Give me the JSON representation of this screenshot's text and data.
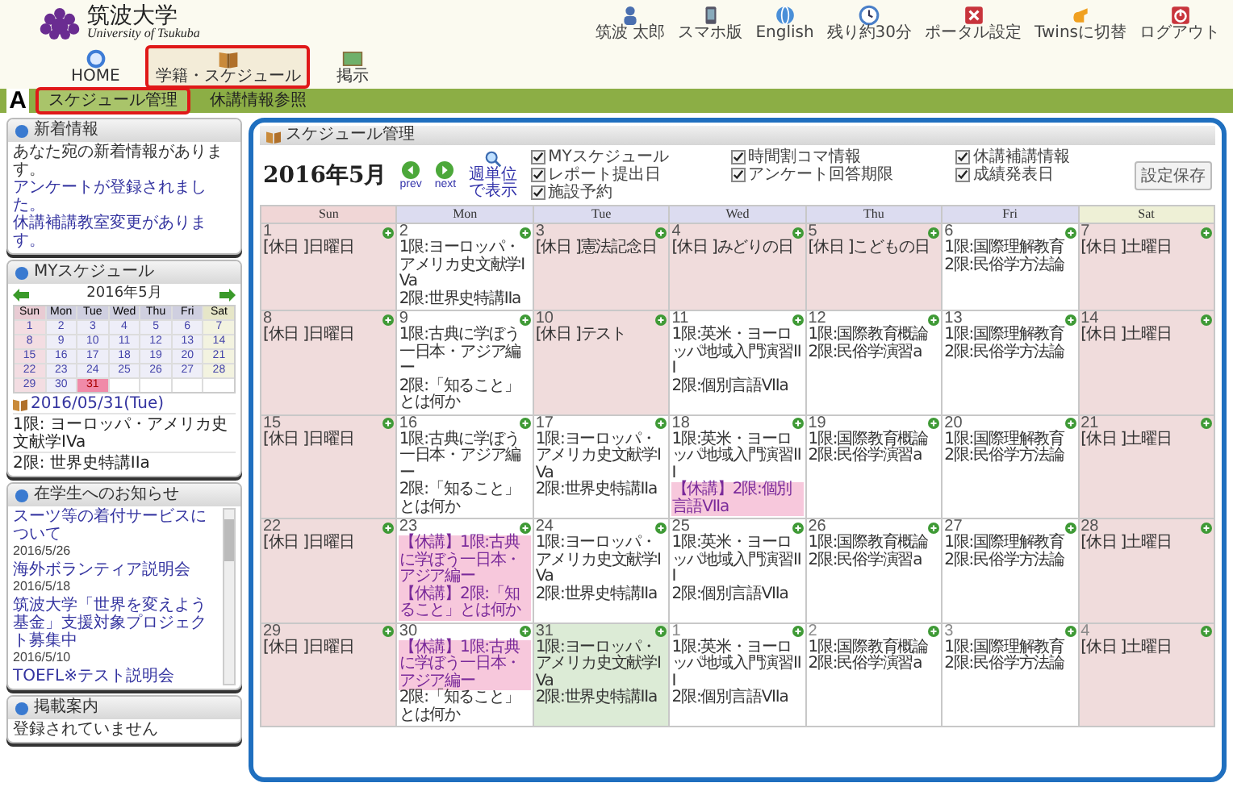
{
  "logo": {
    "name": "筑波大学",
    "subtitle": "University of Tsukuba"
  },
  "top_links": [
    {
      "label": "筑波 太郎"
    },
    {
      "label": "スマホ版"
    },
    {
      "label": "English"
    },
    {
      "label": "残り約30分"
    },
    {
      "label": "ポータル設定"
    },
    {
      "label": "Twinsに切替"
    },
    {
      "label": "ログアウト"
    }
  ],
  "nav": [
    {
      "label": "HOME",
      "selected": false
    },
    {
      "label": "学籍・スケジュール",
      "selected": true
    },
    {
      "label": "掲示",
      "selected": false
    }
  ],
  "annotation_label": "A",
  "subnav": [
    {
      "label": "スケジュール管理",
      "selected": true
    },
    {
      "label": "休講情報参照",
      "selected": false
    }
  ],
  "sidebar": {
    "news": {
      "title": "新着情報",
      "message": "あなた宛の新着情報があります。",
      "links": [
        "アンケートが登録されました。",
        "休講補講教室変更があります。"
      ]
    },
    "my_schedule": {
      "title": "MYスケジュール",
      "month": "2016年5月",
      "weekdays": [
        "Sun",
        "Mon",
        "Tue",
        "Wed",
        "Thu",
        "Fri",
        "Sat"
      ],
      "weeks": [
        [
          {
            "day": "1",
            "selected": false
          },
          {
            "day": "2",
            "selected": false
          },
          {
            "day": "3",
            "selected": false
          },
          {
            "day": "4",
            "selected": false
          },
          {
            "day": "5",
            "selected": false
          },
          {
            "day": "6",
            "selected": false
          },
          {
            "day": "7",
            "selected": false
          }
        ],
        [
          {
            "day": "8",
            "selected": false
          },
          {
            "day": "9",
            "selected": false
          },
          {
            "day": "10",
            "selected": false
          },
          {
            "day": "11",
            "selected": false
          },
          {
            "day": "12",
            "selected": false
          },
          {
            "day": "13",
            "selected": false
          },
          {
            "day": "14",
            "selected": false
          }
        ],
        [
          {
            "day": "15",
            "selected": false
          },
          {
            "day": "16",
            "selected": false
          },
          {
            "day": "17",
            "selected": false
          },
          {
            "day": "18",
            "selected": false
          },
          {
            "day": "19",
            "selected": false
          },
          {
            "day": "20",
            "selected": false
          },
          {
            "day": "21",
            "selected": false
          }
        ],
        [
          {
            "day": "22",
            "selected": false
          },
          {
            "day": "23",
            "selected": false
          },
          {
            "day": "24",
            "selected": false
          },
          {
            "day": "25",
            "selected": false
          },
          {
            "day": "26",
            "selected": false
          },
          {
            "day": "27",
            "selected": false
          },
          {
            "day": "28",
            "selected": false
          }
        ],
        [
          {
            "day": "29",
            "selected": false
          },
          {
            "day": "30",
            "selected": false
          },
          {
            "day": "31",
            "selected": true
          }
        ]
      ],
      "date": "2016/05/31(Tue)",
      "items": [
        "1限: ヨーロッパ・アメリカ史文献学IVa",
        "2限: 世界史特講IIa"
      ]
    },
    "notices": {
      "title": "在学生へのお知らせ",
      "items": [
        {
          "title": "スーツ等の着付サービスについて",
          "date": "2016/5/26"
        },
        {
          "title": "海外ボランティア説明会",
          "date": "2016/5/18"
        },
        {
          "title": "筑波大学「世界を変えよう基金」支援対象プロジェクト募集中",
          "date": "2016/5/10"
        },
        {
          "title": "TOEFL※テスト説明会"
        }
      ]
    },
    "bulletin": {
      "title": "掲載案内",
      "message": "登録されていません"
    }
  },
  "schedule": {
    "title": "スケジュール管理",
    "month": "2016年5月",
    "prev": "prev",
    "next": "next",
    "week_view": "週単位で表示",
    "filters": [
      {
        "label": "MYスケジュール",
        "checked": true
      },
      {
        "label": "時間割コマ情報",
        "checked": true
      },
      {
        "label": "休講補講情報",
        "checked": true
      },
      {
        "label": "レポート提出日",
        "checked": true
      },
      {
        "label": "アンケート回答期限",
        "checked": true
      },
      {
        "label": "成績発表日",
        "checked": true
      },
      {
        "label": "施設予約",
        "checked": true
      }
    ],
    "save_button": "設定保存",
    "weekdays": [
      "Sun",
      "Mon",
      "Tue",
      "Wed",
      "Thu",
      "Fri",
      "Sat"
    ],
    "weeks": [
      [
        {
          "day": "1",
          "holiday": true,
          "selected": false,
          "other_month": false,
          "entries": [
            {
              "text": "[休日 ]日曜日",
              "cancelled": false
            }
          ]
        },
        {
          "day": "2",
          "holiday": false,
          "selected": false,
          "other_month": false,
          "entries": [
            {
              "text": "1限:ヨーロッパ・アメリカ史文献学IVa",
              "cancelled": false
            },
            {
              "text": "2限:世界史特講IIa",
              "cancelled": false
            }
          ]
        },
        {
          "day": "3",
          "holiday": true,
          "selected": false,
          "other_month": false,
          "entries": [
            {
              "text": "[休日 ]憲法記念日",
              "cancelled": false
            }
          ]
        },
        {
          "day": "4",
          "holiday": true,
          "selected": false,
          "other_month": false,
          "entries": [
            {
              "text": "[休日 ]みどりの日",
              "cancelled": false
            }
          ]
        },
        {
          "day": "5",
          "holiday": true,
          "selected": false,
          "other_month": false,
          "entries": [
            {
              "text": "[休日 ]こどもの日",
              "cancelled": false
            }
          ]
        },
        {
          "day": "6",
          "holiday": false,
          "selected": false,
          "other_month": false,
          "entries": [
            {
              "text": "1限:国際理解教育",
              "cancelled": false
            },
            {
              "text": "2限:民俗学方法論",
              "cancelled": false
            }
          ]
        },
        {
          "day": "7",
          "holiday": true,
          "selected": false,
          "other_month": false,
          "entries": [
            {
              "text": "[休日 ]土曜日",
              "cancelled": false
            }
          ]
        }
      ],
      [
        {
          "day": "8",
          "holiday": true,
          "selected": false,
          "other_month": false,
          "entries": [
            {
              "text": "[休日 ]日曜日",
              "cancelled": false
            }
          ]
        },
        {
          "day": "9",
          "holiday": false,
          "selected": false,
          "other_month": false,
          "entries": [
            {
              "text": "1限:古典に学ぼう一日本・アジア編ー",
              "cancelled": false
            },
            {
              "text": "2限:「知ること」とは何か",
              "cancelled": false
            }
          ]
        },
        {
          "day": "10",
          "holiday": true,
          "selected": false,
          "other_month": false,
          "entries": [
            {
              "text": "[休日 ]テスト",
              "cancelled": false
            }
          ]
        },
        {
          "day": "11",
          "holiday": false,
          "selected": false,
          "other_month": false,
          "entries": [
            {
              "text": "1限:英米・ヨーロッパ地域入門演習III",
              "cancelled": false
            },
            {
              "text": "2限:個別言語VIIa",
              "cancelled": false
            }
          ]
        },
        {
          "day": "12",
          "holiday": false,
          "selected": false,
          "other_month": false,
          "entries": [
            {
              "text": "1限:国際教育概論",
              "cancelled": false
            },
            {
              "text": "2限:民俗学演習a",
              "cancelled": false
            }
          ]
        },
        {
          "day": "13",
          "holiday": false,
          "selected": false,
          "other_month": false,
          "entries": [
            {
              "text": "1限:国際理解教育",
              "cancelled": false
            },
            {
              "text": "2限:民俗学方法論",
              "cancelled": false
            }
          ]
        },
        {
          "day": "14",
          "holiday": true,
          "selected": false,
          "other_month": false,
          "entries": [
            {
              "text": "[休日 ]土曜日",
              "cancelled": false
            }
          ]
        }
      ],
      [
        {
          "day": "15",
          "holiday": true,
          "selected": false,
          "other_month": false,
          "entries": [
            {
              "text": "[休日 ]日曜日",
              "cancelled": false
            }
          ]
        },
        {
          "day": "16",
          "holiday": false,
          "selected": false,
          "other_month": false,
          "entries": [
            {
              "text": "1限:古典に学ぼう一日本・アジア編ー",
              "cancelled": false
            },
            {
              "text": "2限:「知ること」とは何か",
              "cancelled": false
            }
          ]
        },
        {
          "day": "17",
          "holiday": false,
          "selected": false,
          "other_month": false,
          "entries": [
            {
              "text": "1限:ヨーロッパ・アメリカ史文献学IVa",
              "cancelled": false
            },
            {
              "text": "2限:世界史特講IIa",
              "cancelled": false
            }
          ]
        },
        {
          "day": "18",
          "holiday": false,
          "selected": false,
          "other_month": false,
          "entries": [
            {
              "text": "1限:英米・ヨーロッパ地域入門演習III",
              "cancelled": false
            },
            {
              "text": "【休講】2限:個別言語VIIa",
              "cancelled": true
            }
          ]
        },
        {
          "day": "19",
          "holiday": false,
          "selected": false,
          "other_month": false,
          "entries": [
            {
              "text": "1限:国際教育概論",
              "cancelled": false
            },
            {
              "text": "2限:民俗学演習a",
              "cancelled": false
            }
          ]
        },
        {
          "day": "20",
          "holiday": false,
          "selected": false,
          "other_month": false,
          "entries": [
            {
              "text": "1限:国際理解教育",
              "cancelled": false
            },
            {
              "text": "2限:民俗学方法論",
              "cancelled": false
            }
          ]
        },
        {
          "day": "21",
          "holiday": true,
          "selected": false,
          "other_month": false,
          "entries": [
            {
              "text": "[休日 ]土曜日",
              "cancelled": false
            }
          ]
        }
      ],
      [
        {
          "day": "22",
          "holiday": true,
          "selected": false,
          "other_month": false,
          "entries": [
            {
              "text": "[休日 ]日曜日",
              "cancelled": false
            }
          ]
        },
        {
          "day": "23",
          "holiday": false,
          "selected": false,
          "other_month": false,
          "entries": [
            {
              "text": "【休講】1限:古典に学ぼう一日本・アジア編ー",
              "cancelled": true
            },
            {
              "text": "【休講】2限:「知ること」とは何か",
              "cancelled": true
            }
          ]
        },
        {
          "day": "24",
          "holiday": false,
          "selected": false,
          "other_month": false,
          "entries": [
            {
              "text": "1限:ヨーロッパ・アメリカ史文献学IVa",
              "cancelled": false
            },
            {
              "text": "2限:世界史特講IIa",
              "cancelled": false
            }
          ]
        },
        {
          "day": "25",
          "holiday": false,
          "selected": false,
          "other_month": false,
          "entries": [
            {
              "text": "1限:英米・ヨーロッパ地域入門演習III",
              "cancelled": false
            },
            {
              "text": "2限:個別言語VIIa",
              "cancelled": false
            }
          ]
        },
        {
          "day": "26",
          "holiday": false,
          "selected": false,
          "other_month": false,
          "entries": [
            {
              "text": "1限:国際教育概論",
              "cancelled": false
            },
            {
              "text": "2限:民俗学演習a",
              "cancelled": false
            }
          ]
        },
        {
          "day": "27",
          "holiday": false,
          "selected": false,
          "other_month": false,
          "entries": [
            {
              "text": "1限:国際理解教育",
              "cancelled": false
            },
            {
              "text": "2限:民俗学方法論",
              "cancelled": false
            }
          ]
        },
        {
          "day": "28",
          "holiday": true,
          "selected": false,
          "other_month": false,
          "entries": [
            {
              "text": "[休日 ]土曜日",
              "cancelled": false
            }
          ]
        }
      ],
      [
        {
          "day": "29",
          "holiday": true,
          "selected": false,
          "other_month": false,
          "entries": [
            {
              "text": "[休日 ]日曜日",
              "cancelled": false
            }
          ]
        },
        {
          "day": "30",
          "holiday": false,
          "selected": false,
          "other_month": false,
          "entries": [
            {
              "text": "【休講】1限:古典に学ぼう一日本・アジア編ー",
              "cancelled": true
            },
            {
              "text": "2限:「知ること」とは何か",
              "cancelled": false
            }
          ]
        },
        {
          "day": "31",
          "holiday": false,
          "selected": true,
          "other_month": false,
          "entries": [
            {
              "text": "1限:ヨーロッパ・アメリカ史文献学IVa",
              "cancelled": false
            },
            {
              "text": "2限:世界史特講IIa",
              "cancelled": false
            }
          ]
        },
        {
          "day": "1",
          "holiday": false,
          "selected": false,
          "other_month": true,
          "entries": [
            {
              "text": "1限:英米・ヨーロッパ地域入門演習III",
              "cancelled": false
            },
            {
              "text": "2限:個別言語VIIa",
              "cancelled": false
            }
          ]
        },
        {
          "day": "2",
          "holiday": false,
          "selected": false,
          "other_month": true,
          "entries": [
            {
              "text": "1限:国際教育概論",
              "cancelled": false
            },
            {
              "text": "2限:民俗学演習a",
              "cancelled": false
            }
          ]
        },
        {
          "day": "3",
          "holiday": false,
          "selected": false,
          "other_month": true,
          "entries": [
            {
              "text": "1限:国際理解教育",
              "cancelled": false
            },
            {
              "text": "2限:民俗学方法論",
              "cancelled": false
            }
          ]
        },
        {
          "day": "4",
          "holiday": true,
          "selected": false,
          "other_month": true,
          "entries": [
            {
              "text": "[休日 ]土曜日",
              "cancelled": false
            }
          ]
        }
      ]
    ]
  }
}
